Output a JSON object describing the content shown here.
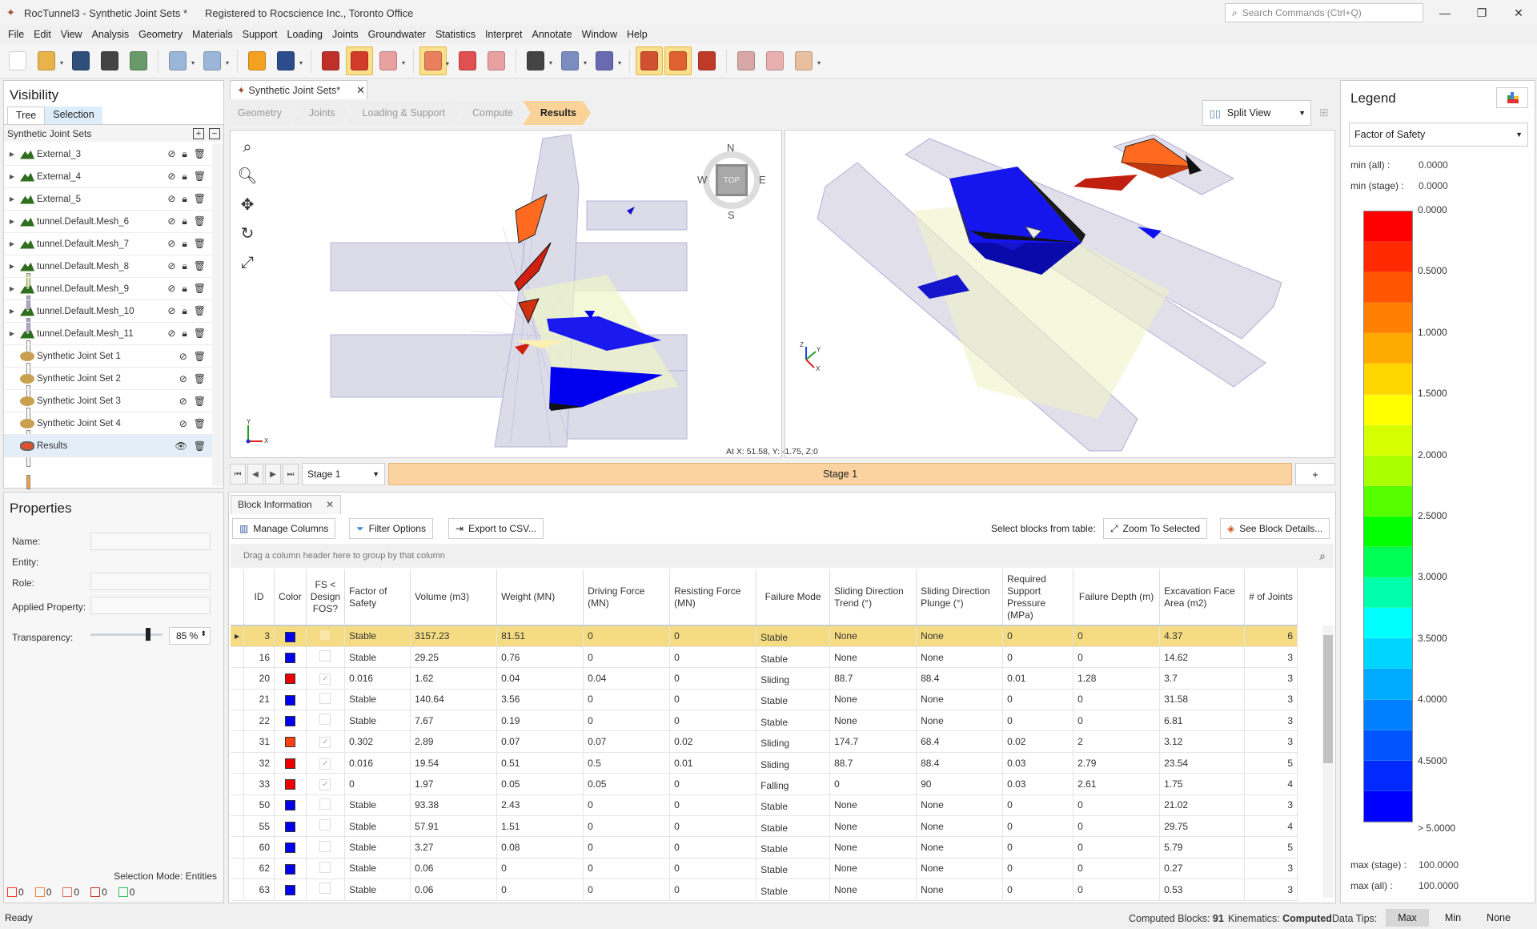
{
  "window": {
    "title": "RocTunnel3 - Synthetic Joint Sets *",
    "registered": "Registered to Rocscience Inc., Toronto Office",
    "search_placeholder": "Search Commands (Ctrl+Q)",
    "controls": {
      "minimize": "—",
      "restore": "❐",
      "close": "✕"
    }
  },
  "menu": [
    "File",
    "Edit",
    "View",
    "Analysis",
    "Geometry",
    "Materials",
    "Support",
    "Loading",
    "Joints",
    "Groundwater",
    "Statistics",
    "Interpret",
    "Annotate",
    "Window",
    "Help"
  ],
  "toolbar": [
    {
      "name": "new-file-icon",
      "color": "#ffffff",
      "active": false
    },
    {
      "name": "open-folder-icon",
      "color": "#e8b44a",
      "active": false,
      "dropdown": true
    },
    {
      "name": "save-icon",
      "color": "#2f4f7a",
      "active": false
    },
    {
      "name": "print-icon",
      "color": "#444444",
      "active": false
    },
    {
      "name": "report-icon",
      "color": "#6a9a6a",
      "active": false
    },
    {
      "name": "undo-icon",
      "color": "#9ab6d8",
      "active": false,
      "dropdown": true
    },
    {
      "name": "redo-icon",
      "color": "#9ab6d8",
      "active": false,
      "dropdown": true
    },
    {
      "name": "color-wheel-icon",
      "color": "#f4a020",
      "active": false
    },
    {
      "name": "image-icon",
      "color": "#2c4c8c",
      "active": false,
      "dropdown": true
    },
    {
      "name": "edit-document-icon",
      "color": "#c0302a",
      "active": false
    },
    {
      "name": "solid-block-icon",
      "color": "#d23a2a",
      "active": true
    },
    {
      "name": "wireframe-block-icon",
      "color": "#e8a0a0",
      "active": false,
      "dropdown": true
    },
    {
      "name": "select-region-icon",
      "color": "#e88060",
      "active": true,
      "dropdown": true
    },
    {
      "name": "lock-selection-icon",
      "color": "#e05050",
      "active": false
    },
    {
      "name": "clear-selection-icon",
      "color": "#e8a0a0",
      "active": false
    },
    {
      "name": "pen-tool-icon",
      "color": "#444444",
      "active": false,
      "dropdown": true
    },
    {
      "name": "shapes-icon",
      "color": "#7a8cc0",
      "active": false,
      "dropdown": true
    },
    {
      "name": "import-icon",
      "color": "#6a6ab0",
      "active": false,
      "dropdown": true
    },
    {
      "name": "block-info-icon",
      "color": "#d05030",
      "active": true
    },
    {
      "name": "block-colormap-icon",
      "color": "#e06030",
      "active": true
    },
    {
      "name": "block-settings-icon",
      "color": "#c03a2a",
      "active": false
    },
    {
      "name": "eraser-icon",
      "color": "#d8a8a8",
      "active": false
    },
    {
      "name": "tools-icon",
      "color": "#e8b0b0",
      "active": false
    },
    {
      "name": "measure-icon",
      "color": "#e8c0a0",
      "active": false,
      "dropdown": true
    }
  ],
  "visibility": {
    "title": "Visibility",
    "tabs": [
      "Tree",
      "Selection"
    ],
    "root": "Synthetic Joint Sets",
    "items": [
      {
        "label": "External_3",
        "color": "#e6ea9a",
        "type": "mesh",
        "expandable": true,
        "hidden": true,
        "locked": true
      },
      {
        "label": "External_4",
        "color": "#b8a4d8",
        "type": "mesh",
        "expandable": true,
        "hidden": true,
        "locked": true
      },
      {
        "label": "External_5",
        "color": "#b8a4d8",
        "type": "mesh",
        "expandable": true,
        "hidden": true,
        "locked": true
      },
      {
        "label": "tunnel.Default.Mesh_6",
        "color": "",
        "type": "mesh",
        "expandable": true,
        "hidden": true,
        "locked": true
      },
      {
        "label": "tunnel.Default.Mesh_7",
        "color": "",
        "type": "mesh",
        "expandable": true,
        "hidden": true,
        "locked": true
      },
      {
        "label": "tunnel.Default.Mesh_8",
        "color": "",
        "type": "mesh",
        "expandable": true,
        "hidden": true,
        "locked": true
      },
      {
        "label": "tunnel.Default.Mesh_9",
        "color": "",
        "type": "mesh",
        "expandable": true,
        "hidden": true,
        "locked": true
      },
      {
        "label": "tunnel.Default.Mesh_10",
        "color": "",
        "type": "mesh",
        "expandable": true,
        "hidden": true,
        "locked": true
      },
      {
        "label": "tunnel.Default.Mesh_11",
        "color": "",
        "type": "mesh",
        "expandable": true,
        "hidden": true,
        "locked": true
      },
      {
        "label": "Synthetic Joint Set 1",
        "color": "#f4a040",
        "type": "joint",
        "expandable": false,
        "hidden": true,
        "locked": false
      },
      {
        "label": "Synthetic Joint Set 2",
        "color": "#c8f040",
        "type": "joint",
        "expandable": false,
        "hidden": true,
        "locked": false
      },
      {
        "label": "Synthetic Joint Set 3",
        "color": "#f8e040",
        "type": "joint",
        "expandable": false,
        "hidden": true,
        "locked": false
      },
      {
        "label": "Synthetic Joint Set 4",
        "color": "#50a8f0",
        "type": "joint",
        "expandable": false,
        "hidden": true,
        "locked": false
      },
      {
        "label": "Results",
        "color": "#b8a4d8",
        "type": "results",
        "expandable": false,
        "hidden": false,
        "locked": false,
        "selected": true
      }
    ]
  },
  "properties": {
    "title": "Properties",
    "name_label": "Name:",
    "entity_label": "Entity:",
    "role_label": "Role:",
    "applied_property_label": "Applied Property:",
    "transparency_label": "Transparency:",
    "transparency_value": "85 %",
    "transparency_fraction": 0.85,
    "selection_mode": "Selection Mode: Entities",
    "counts": [
      {
        "name": "vertex-count",
        "value": "0",
        "color": "#ff3020"
      },
      {
        "name": "edge-count",
        "value": "0",
        "color": "#f08040"
      },
      {
        "name": "face-count",
        "value": "0",
        "color": "#e07060"
      },
      {
        "name": "block-count",
        "value": "0",
        "color": "#c03028"
      },
      {
        "name": "entity-count",
        "value": "0",
        "color": "#30c060"
      }
    ]
  },
  "document": {
    "tab_label": "Synthetic Joint Sets*",
    "workflow": [
      "Geometry",
      "Joints",
      "Loading & Support",
      "Compute",
      "Results"
    ],
    "active_step": "Results",
    "view_mode": "Split View",
    "compass": {
      "n": "N",
      "s": "S",
      "e": "E",
      "w": "W",
      "top": "TOP"
    },
    "cursor_coord": "At X: 51.58, Y: -1.75, Z:0",
    "stage_select": "Stage 1",
    "stage_bar": "Stage 1",
    "add_stage": "+"
  },
  "block_info": {
    "tab_label": "Block Information",
    "buttons": {
      "manage_columns": "Manage Columns",
      "filter_options": "Filter Options",
      "export_csv": "Export to CSV...",
      "zoom_selected": "Zoom To Selected",
      "see_details": "See Block Details..."
    },
    "select_from_table": "Select blocks from table:",
    "group_hint": "Drag a column header here to group by that column",
    "columns": [
      "ID",
      "Color",
      "FS < Design FOS?",
      "Factor of Safety",
      "Volume (m3)",
      "Weight (MN)",
      "Driving Force (MN)",
      "Resisting Force (MN)",
      "Failure Mode",
      "Sliding Direction Trend (°)",
      "Sliding Direction Plunge (°)",
      "Required Support Pressure (MPa)",
      "Failure Depth (m)",
      "Excavation Face Area (m2)",
      "# of Joints"
    ],
    "rows": [
      {
        "id": "3",
        "color": "#0000ee",
        "below": false,
        "fs": "Stable",
        "vol": "3157.23",
        "wt": "81.51",
        "drv": "0",
        "res": "0",
        "mode": "Stable",
        "trend": "None",
        "plunge": "None",
        "press": "0",
        "depth": "0",
        "area": "4.37",
        "joints": "6",
        "selected": true
      },
      {
        "id": "16",
        "color": "#0000ee",
        "below": false,
        "fs": "Stable",
        "vol": "29.25",
        "wt": "0.76",
        "drv": "0",
        "res": "0",
        "mode": "Stable",
        "trend": "None",
        "plunge": "None",
        "press": "0",
        "depth": "0",
        "area": "14.62",
        "joints": "3"
      },
      {
        "id": "20",
        "color": "#ee0000",
        "below": true,
        "fs": "0.016",
        "vol": "1.62",
        "wt": "0.04",
        "drv": "0.04",
        "res": "0",
        "mode": "Sliding",
        "trend": "88.7",
        "plunge": "88.4",
        "press": "0.01",
        "depth": "1.28",
        "area": "3.7",
        "joints": "3"
      },
      {
        "id": "21",
        "color": "#0000ee",
        "below": false,
        "fs": "Stable",
        "vol": "140.64",
        "wt": "3.56",
        "drv": "0",
        "res": "0",
        "mode": "Stable",
        "trend": "None",
        "plunge": "None",
        "press": "0",
        "depth": "0",
        "area": "31.58",
        "joints": "3"
      },
      {
        "id": "22",
        "color": "#0000ee",
        "below": false,
        "fs": "Stable",
        "vol": "7.67",
        "wt": "0.19",
        "drv": "0",
        "res": "0",
        "mode": "Stable",
        "trend": "None",
        "plunge": "None",
        "press": "0",
        "depth": "0",
        "area": "6.81",
        "joints": "3"
      },
      {
        "id": "31",
        "color": "#ff4010",
        "below": true,
        "fs": "0.302",
        "vol": "2.89",
        "wt": "0.07",
        "drv": "0.07",
        "res": "0.02",
        "mode": "Sliding",
        "trend": "174.7",
        "plunge": "68.4",
        "press": "0.02",
        "depth": "2",
        "area": "3.12",
        "joints": "3"
      },
      {
        "id": "32",
        "color": "#ee0000",
        "below": true,
        "fs": "0.016",
        "vol": "19.54",
        "wt": "0.51",
        "drv": "0.5",
        "res": "0.01",
        "mode": "Sliding",
        "trend": "88.7",
        "plunge": "88.4",
        "press": "0.03",
        "depth": "2.79",
        "area": "23.54",
        "joints": "5"
      },
      {
        "id": "33",
        "color": "#ee0000",
        "below": true,
        "fs": "0",
        "vol": "1.97",
        "wt": "0.05",
        "drv": "0.05",
        "res": "0",
        "mode": "Falling",
        "trend": "0",
        "plunge": "90",
        "press": "0.03",
        "depth": "2.61",
        "area": "1.75",
        "joints": "4"
      },
      {
        "id": "50",
        "color": "#0000ee",
        "below": false,
        "fs": "Stable",
        "vol": "93.38",
        "wt": "2.43",
        "drv": "0",
        "res": "0",
        "mode": "Stable",
        "trend": "None",
        "plunge": "None",
        "press": "0",
        "depth": "0",
        "area": "21.02",
        "joints": "3"
      },
      {
        "id": "55",
        "color": "#0000ee",
        "below": false,
        "fs": "Stable",
        "vol": "57.91",
        "wt": "1.51",
        "drv": "0",
        "res": "0",
        "mode": "Stable",
        "trend": "None",
        "plunge": "None",
        "press": "0",
        "depth": "0",
        "area": "29.75",
        "joints": "4"
      },
      {
        "id": "60",
        "color": "#0000ee",
        "below": false,
        "fs": "Stable",
        "vol": "3.27",
        "wt": "0.08",
        "drv": "0",
        "res": "0",
        "mode": "Stable",
        "trend": "None",
        "plunge": "None",
        "press": "0",
        "depth": "0",
        "area": "5.79",
        "joints": "5"
      },
      {
        "id": "62",
        "color": "#0000ee",
        "below": false,
        "fs": "Stable",
        "vol": "0.06",
        "wt": "0",
        "drv": "0",
        "res": "0",
        "mode": "Stable",
        "trend": "None",
        "plunge": "None",
        "press": "0",
        "depth": "0",
        "area": "0.27",
        "joints": "3"
      },
      {
        "id": "63",
        "color": "#0000ee",
        "below": false,
        "fs": "Stable",
        "vol": "0.06",
        "wt": "0",
        "drv": "0",
        "res": "0",
        "mode": "Stable",
        "trend": "None",
        "plunge": "None",
        "press": "0",
        "depth": "0",
        "area": "0.53",
        "joints": "3"
      }
    ]
  },
  "legend": {
    "title": "Legend",
    "quantity": "Factor of Safety",
    "min_all_label": "min (all) :",
    "min_all": "0.0000",
    "min_stage_label": "min (stage) :",
    "min_stage": "0.0000",
    "max_stage_label": "max (stage) :",
    "max_stage": "100.0000",
    "max_all_label": "max (all) :",
    "max_all": "100.0000",
    "ticks": [
      "0.0000",
      "0.5000",
      "1.0000",
      "1.5000",
      "2.0000",
      "2.5000",
      "3.0000",
      "3.5000",
      "4.0000",
      "4.5000",
      "> 5.0000"
    ],
    "colors": [
      "#ff0000",
      "#ff2a00",
      "#ff5500",
      "#ff8000",
      "#ffaa00",
      "#ffd500",
      "#ffff00",
      "#d5ff00",
      "#aaff00",
      "#55ff00",
      "#00ff00",
      "#00ff55",
      "#00ffaa",
      "#00ffff",
      "#00d5ff",
      "#00aaff",
      "#0080ff",
      "#0055ff",
      "#002aff",
      "#0000ff"
    ]
  },
  "status": {
    "ready": "Ready",
    "computed_blocks_label": "Computed Blocks:",
    "computed_blocks": "91",
    "kinematics_label": "Kinematics:",
    "kinematics": "Computed",
    "data_tips_label": "Data Tips:",
    "data_tips_options": [
      "Max",
      "Min",
      "None"
    ],
    "data_tips_selected": "Max"
  }
}
